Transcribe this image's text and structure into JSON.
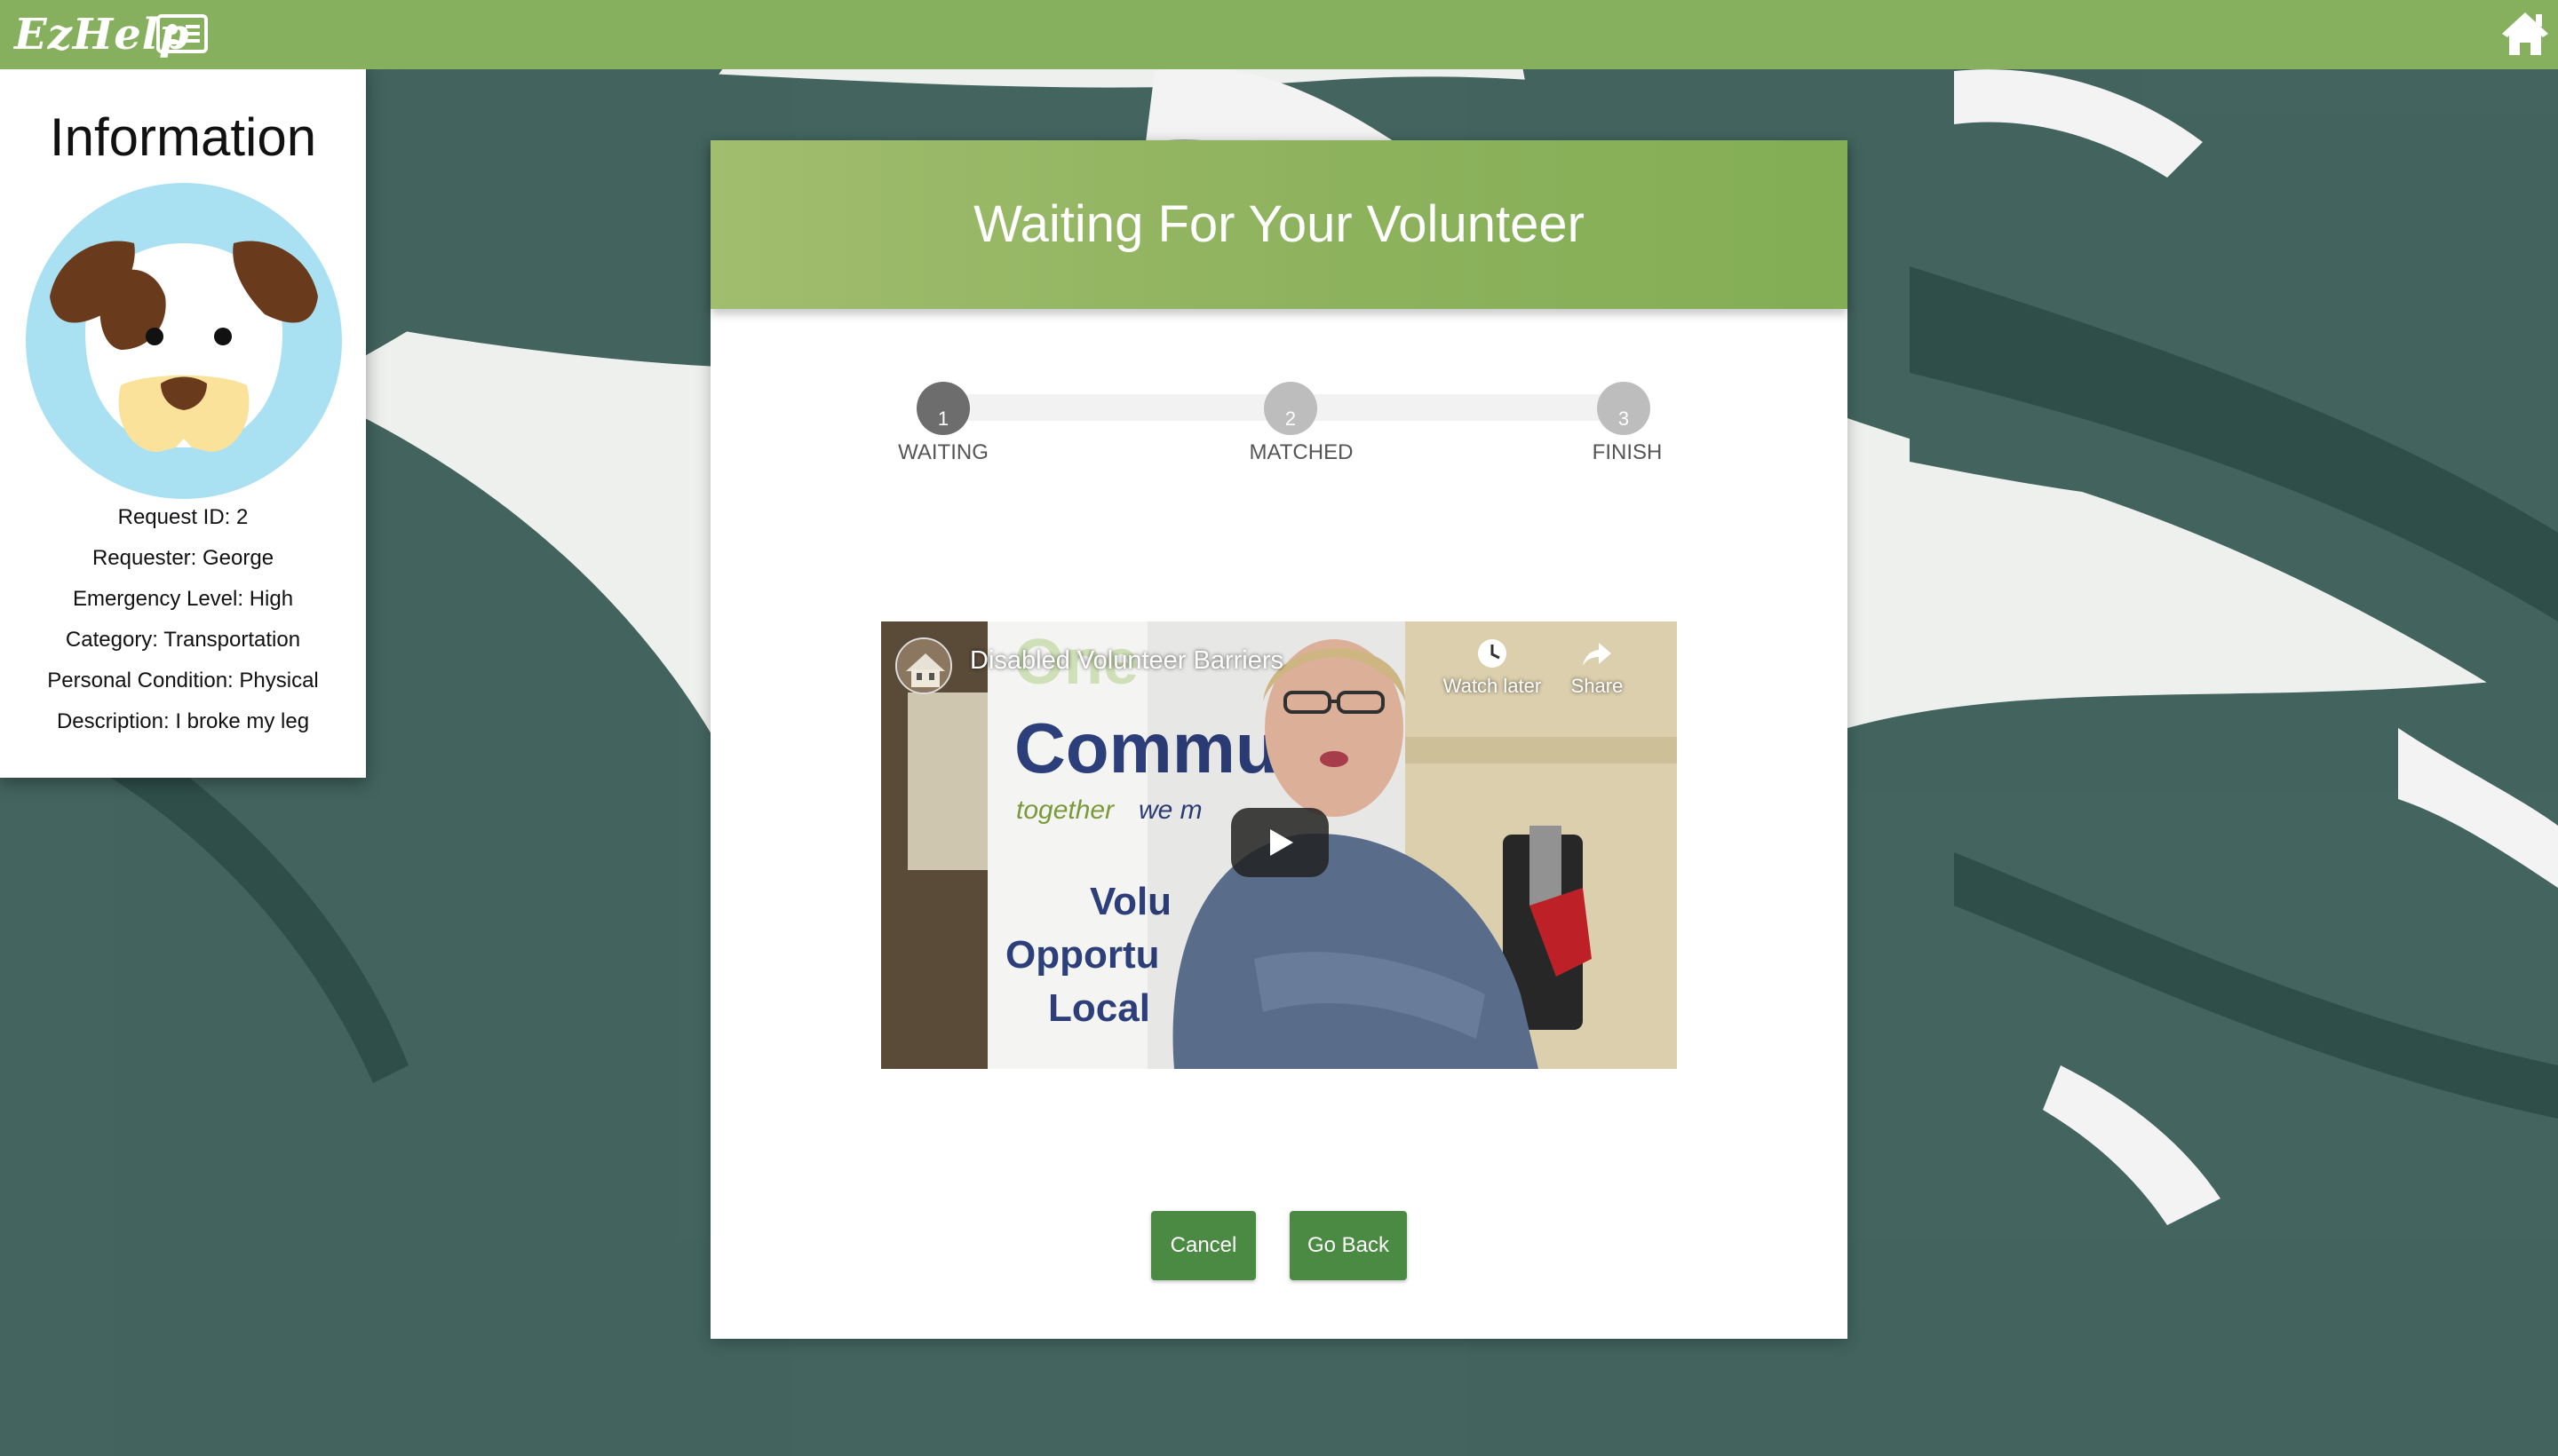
{
  "app": {
    "logo_text": "EzHelp"
  },
  "topbar": {
    "id_icon": "id-card-icon",
    "home_icon": "home-icon"
  },
  "info": {
    "title": "Information",
    "avatar": "dog-avatar",
    "lines": [
      "Request ID: 2",
      "Requester: George",
      "Emergency Level: High",
      "Category: Transportation",
      "Personal Condition: Physical",
      "Description: I broke my leg"
    ]
  },
  "card": {
    "title": "Waiting For Your Volunteer",
    "steps": [
      {
        "number": "1",
        "label": "WAITING",
        "state": "active"
      },
      {
        "number": "2",
        "label": "MATCHED",
        "state": "inactive"
      },
      {
        "number": "3",
        "label": "FINISH",
        "state": "inactive"
      }
    ]
  },
  "video": {
    "title": "Disabled Volunteer Barriers",
    "watch_later": "Watch later",
    "share": "Share",
    "poster_text": {
      "line1": "One",
      "line2": "Commu",
      "line3": "together",
      "line3b": "we m",
      "line4": "Volu",
      "line5": "Opportu",
      "line6": "Local"
    }
  },
  "buttons": {
    "cancel": "Cancel",
    "go_back": "Go Back"
  },
  "colors": {
    "topbar": "#86b05d",
    "header": "#8db25d",
    "button": "#4a8a42",
    "step_active": "#6d6d6d",
    "step_inactive": "#bdbdbd"
  }
}
